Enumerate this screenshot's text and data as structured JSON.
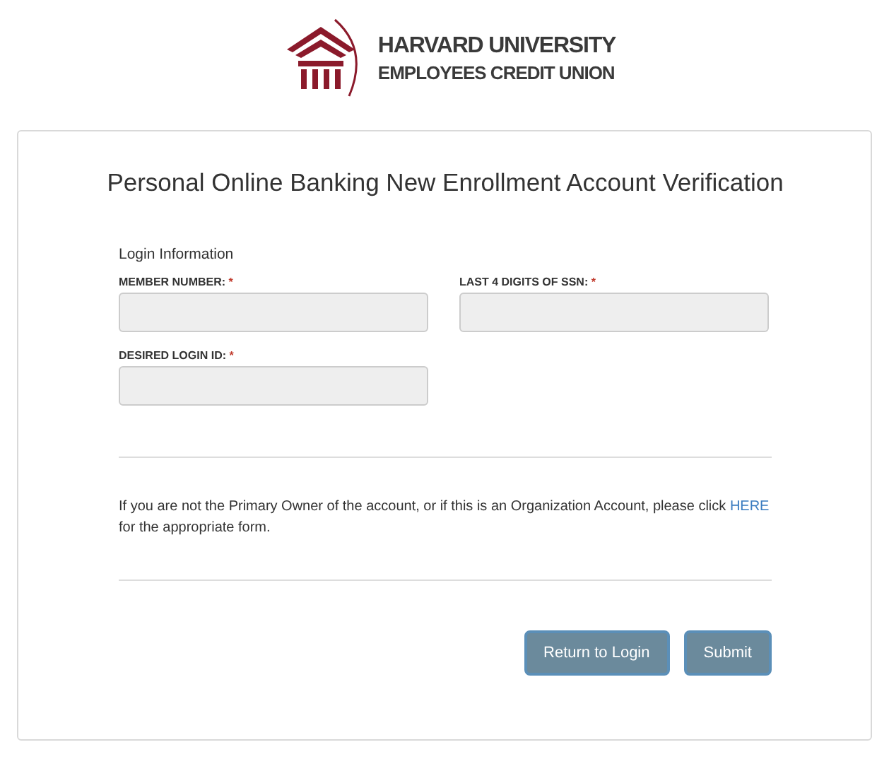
{
  "logo": {
    "line1": "HARVARD UNIVERSITY",
    "line2": "EMPLOYEES CREDIT UNION"
  },
  "title": "Personal Online Banking New Enrollment Account Verification",
  "section_label": "Login Information",
  "fields": [
    {
      "label": "MEMBER NUMBER:",
      "required_mark": "*"
    },
    {
      "label": "LAST 4 DIGITS OF SSN:",
      "required_mark": "*"
    },
    {
      "label": "DESIRED LOGIN ID:",
      "required_mark": "*"
    }
  ],
  "notice": {
    "before": "If you are not the Primary Owner of the account, or if this is an Organization Account, please click",
    "link": "HERE",
    "after": "for the appropriate form."
  },
  "buttons": [
    {
      "label": "Return to Login"
    },
    {
      "label": "Submit"
    }
  ]
}
